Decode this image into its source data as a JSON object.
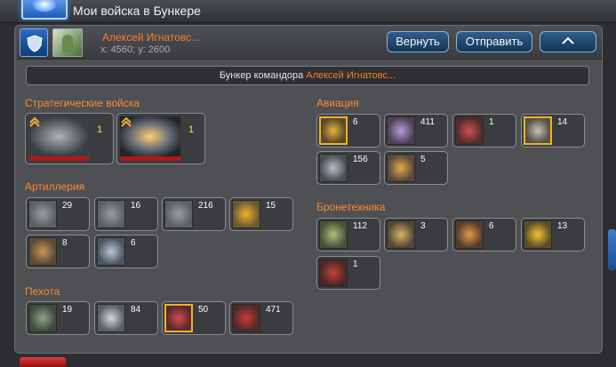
{
  "window": {
    "title": "Мои войска в Бункере"
  },
  "user": {
    "name": "Алексей Игнатовс...",
    "coords": "x: 4560; y: 2600"
  },
  "buttons": {
    "return": "Вернуть",
    "send": "Отправить"
  },
  "bunker": {
    "prefix": "Бункер командора",
    "owner": "Алексей Игнатовс..."
  },
  "sections": {
    "strategic": {
      "title": "Стратегические войска",
      "units": [
        {
          "count": "1",
          "icon": "mech-walker-icon"
        },
        {
          "count": "1",
          "icon": "space-cruiser-icon"
        }
      ]
    },
    "artillery": {
      "title": "Артиллерия",
      "units": [
        {
          "count": "29",
          "icon": "artillery-tank-icon"
        },
        {
          "count": "16",
          "icon": "artillery-walker-icon"
        },
        {
          "count": "216",
          "icon": "artillery-drone-icon"
        },
        {
          "count": "15",
          "icon": "artillery-gold-icon",
          "gold": true
        },
        {
          "count": "8",
          "icon": "artillery-rover-icon"
        },
        {
          "count": "6",
          "icon": "artillery-jet-icon"
        }
      ]
    },
    "infantry": {
      "title": "Пехота",
      "units": [
        {
          "count": "19",
          "icon": "infantry-soldier-icon"
        },
        {
          "count": "84",
          "icon": "infantry-robot-icon"
        },
        {
          "count": "50",
          "icon": "infantry-elite-icon",
          "gold": true
        },
        {
          "count": "471",
          "icon": "infantry-heavy-icon"
        }
      ]
    },
    "aviation": {
      "title": "Авиация",
      "units": [
        {
          "count": "6",
          "icon": "aircraft-gold-icon",
          "gold": true
        },
        {
          "count": "411",
          "icon": "aircraft-fighter-icon"
        },
        {
          "count": "1",
          "icon": "aircraft-red-icon"
        },
        {
          "count": "14",
          "icon": "aircraft-bomber-icon",
          "gold": true
        },
        {
          "count": "156",
          "icon": "aircraft-gunship-icon"
        },
        {
          "count": "5",
          "icon": "aircraft-interceptor-icon"
        }
      ]
    },
    "armor": {
      "title": "Бронетехника",
      "units": [
        {
          "count": "112",
          "icon": "tank-light-icon"
        },
        {
          "count": "3",
          "icon": "tank-hover-icon"
        },
        {
          "count": "6",
          "icon": "tank-assault-icon"
        },
        {
          "count": "13",
          "icon": "tank-gold-icon"
        },
        {
          "count": "1",
          "icon": "tank-red-walker-icon"
        }
      ]
    }
  },
  "colors": {
    "accent": "#ff8a2e",
    "button": "#1f4a73",
    "gold": "#f3b12a"
  }
}
